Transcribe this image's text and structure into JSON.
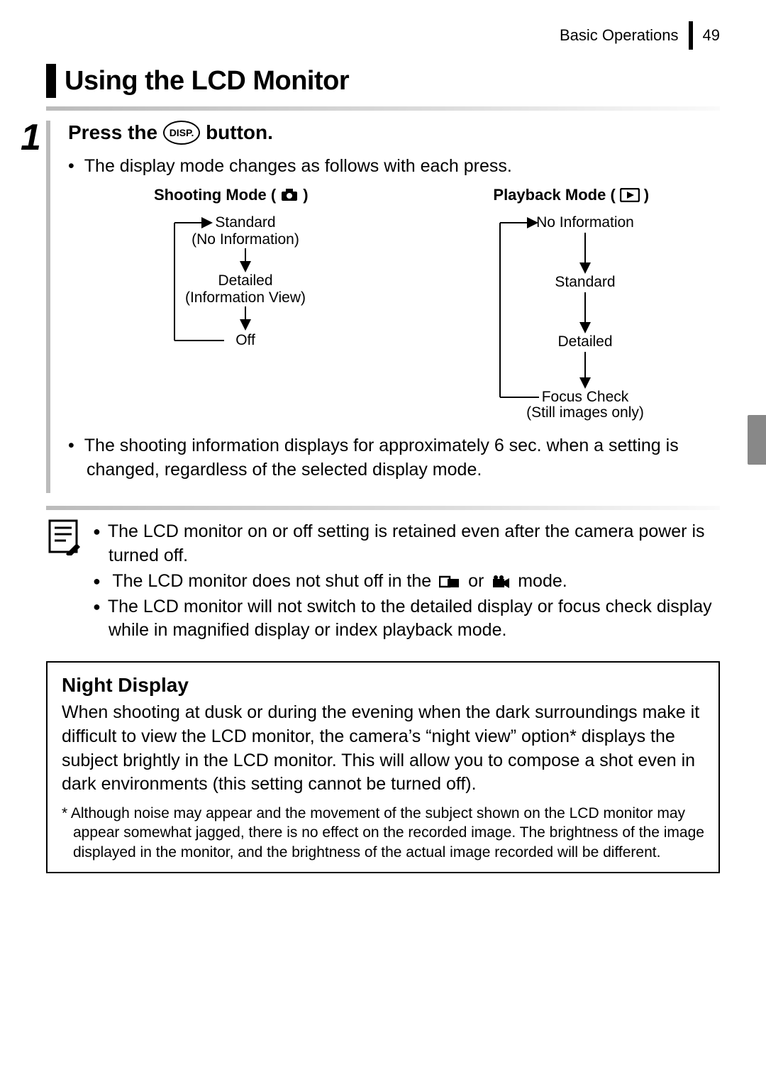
{
  "header": {
    "section": "Basic Operations",
    "page": "49"
  },
  "title": "Using the LCD Monitor",
  "step": {
    "number": "1",
    "title_pre": "Press the",
    "title_post": "button.",
    "disp_label": "DISP.",
    "bullet1": "The display mode changes as follows with each press.",
    "bullet2": "The shooting information displays for approximately 6 sec. when a setting is changed, regardless of the selected display mode."
  },
  "modes": {
    "shooting": {
      "heading": "Shooting Mode (",
      "heading_end": ")",
      "items": [
        "Standard",
        "(No Information)",
        "Detailed",
        "(Information View)",
        "Off"
      ]
    },
    "playback": {
      "heading": "Playback Mode (",
      "heading_end": ")",
      "items": [
        "No Information",
        "Standard",
        "Detailed",
        "Focus Check",
        "(Still images only)"
      ]
    }
  },
  "notes": {
    "n1": "The LCD monitor on or off setting is retained even after the camera power is turned off.",
    "n2a": "The LCD monitor does not shut off in the ",
    "n2b": " or ",
    "n2c": " mode.",
    "n3": "The LCD monitor will not switch to the detailed display or focus check display while in magnified display or index playback mode."
  },
  "night": {
    "title": "Night Display",
    "body": "When shooting at dusk or during the evening when the dark surroundings make it difficult to view the LCD monitor, the camera’s “night view” option* displays the subject brightly in the LCD monitor. This will allow you to compose a shot even in dark environments (this setting cannot be turned off).",
    "footnote": "* Although noise may appear and the movement of the subject shown on the LCD monitor may appear somewhat jagged, there is no effect on the recorded image. The brightness of the image displayed in the monitor, and the brightness of the actual image recorded will be different."
  }
}
